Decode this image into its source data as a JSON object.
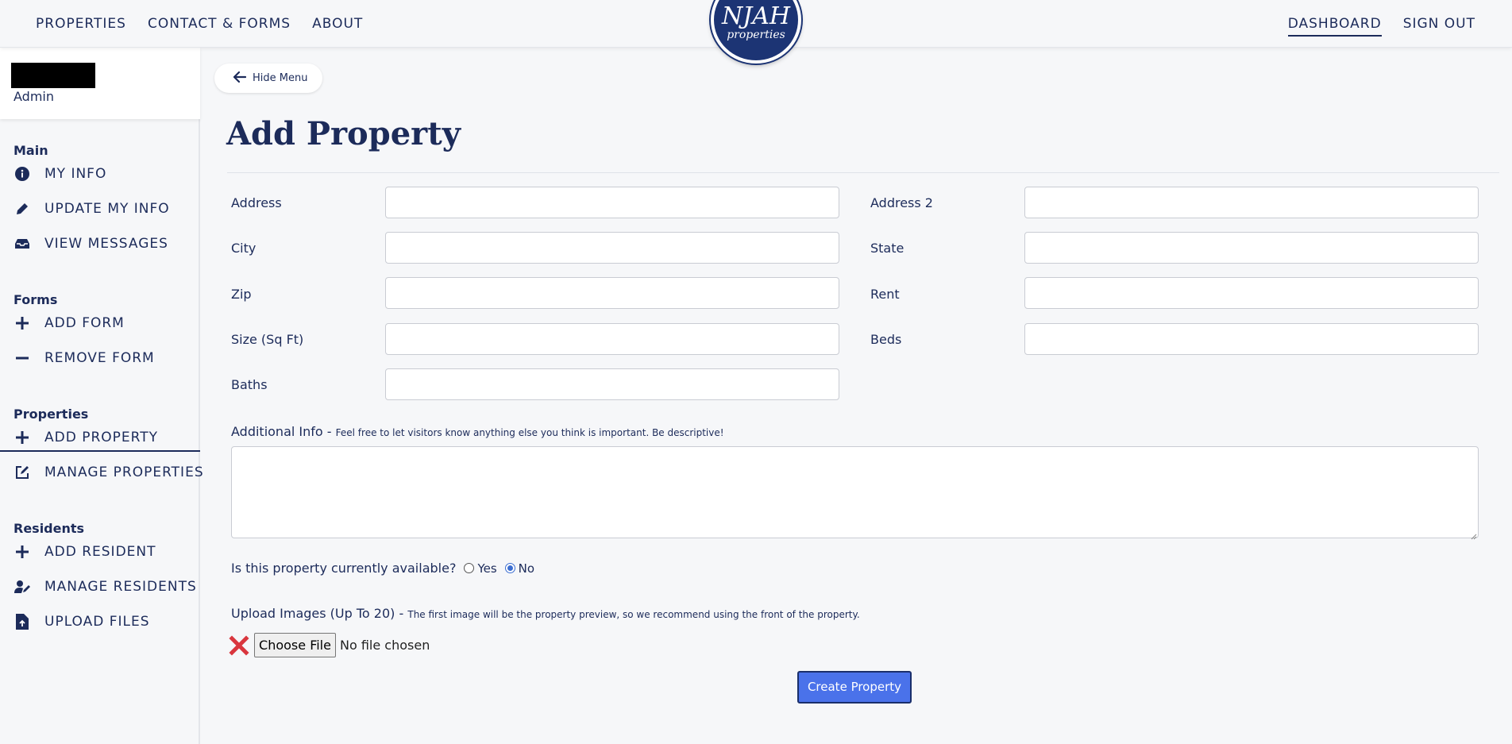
{
  "topnav": {
    "left_links": [
      "PROPERTIES",
      "CONTACT & FORMS",
      "ABOUT"
    ],
    "right_links": [
      "DASHBOARD",
      "SIGN OUT"
    ],
    "logo_line1": "NJAH",
    "logo_line2": "properties"
  },
  "sidebar": {
    "user_role": "Admin",
    "sections": {
      "main": "Main",
      "forms": "Forms",
      "properties": "Properties",
      "residents": "Residents"
    },
    "items": {
      "my_info": "MY INFO",
      "update_my_info": "UPDATE MY INFO",
      "view_messages": "VIEW MESSAGES",
      "add_form": "ADD FORM",
      "remove_form": "REMOVE FORM",
      "add_property": "ADD PROPERTY",
      "manage_properties": "MANAGE PROPERTIES",
      "add_resident": "ADD RESIDENT",
      "manage_residents": "MANAGE RESIDENTS",
      "upload_files": "UPLOAD FILES"
    },
    "active_item": "add_property"
  },
  "main": {
    "hide_menu_label": "Hide Menu",
    "title": "Add Property",
    "fields": {
      "address": {
        "label": "Address",
        "value": ""
      },
      "address2": {
        "label": "Address 2",
        "value": ""
      },
      "city": {
        "label": "City",
        "value": ""
      },
      "state": {
        "label": "State",
        "value": ""
      },
      "zip": {
        "label": "Zip",
        "value": ""
      },
      "rent": {
        "label": "Rent",
        "value": ""
      },
      "size": {
        "label": "Size (Sq Ft)",
        "value": ""
      },
      "beds": {
        "label": "Beds",
        "value": ""
      },
      "baths": {
        "label": "Baths",
        "value": ""
      }
    },
    "additional_info": {
      "label": "Additional Info -",
      "hint": "Feel free to let visitors know anything else you think is important. Be descriptive!",
      "value": ""
    },
    "availability": {
      "question": "Is this property currently available?",
      "options": [
        "Yes",
        "No"
      ],
      "selected": "No"
    },
    "upload": {
      "label": "Upload Images (Up To 20) -",
      "hint": "The first image will be the property preview, so we recommend using the front of the property.",
      "button_label": "Choose File",
      "status": "No file chosen"
    },
    "submit_label": "Create Property"
  },
  "colors": {
    "navy": "#1c2b5a",
    "logo_bg": "#1c3474",
    "button_blue": "#4a72ea",
    "remove_red": "#d9363e",
    "page_bg": "#f6f7f9"
  }
}
